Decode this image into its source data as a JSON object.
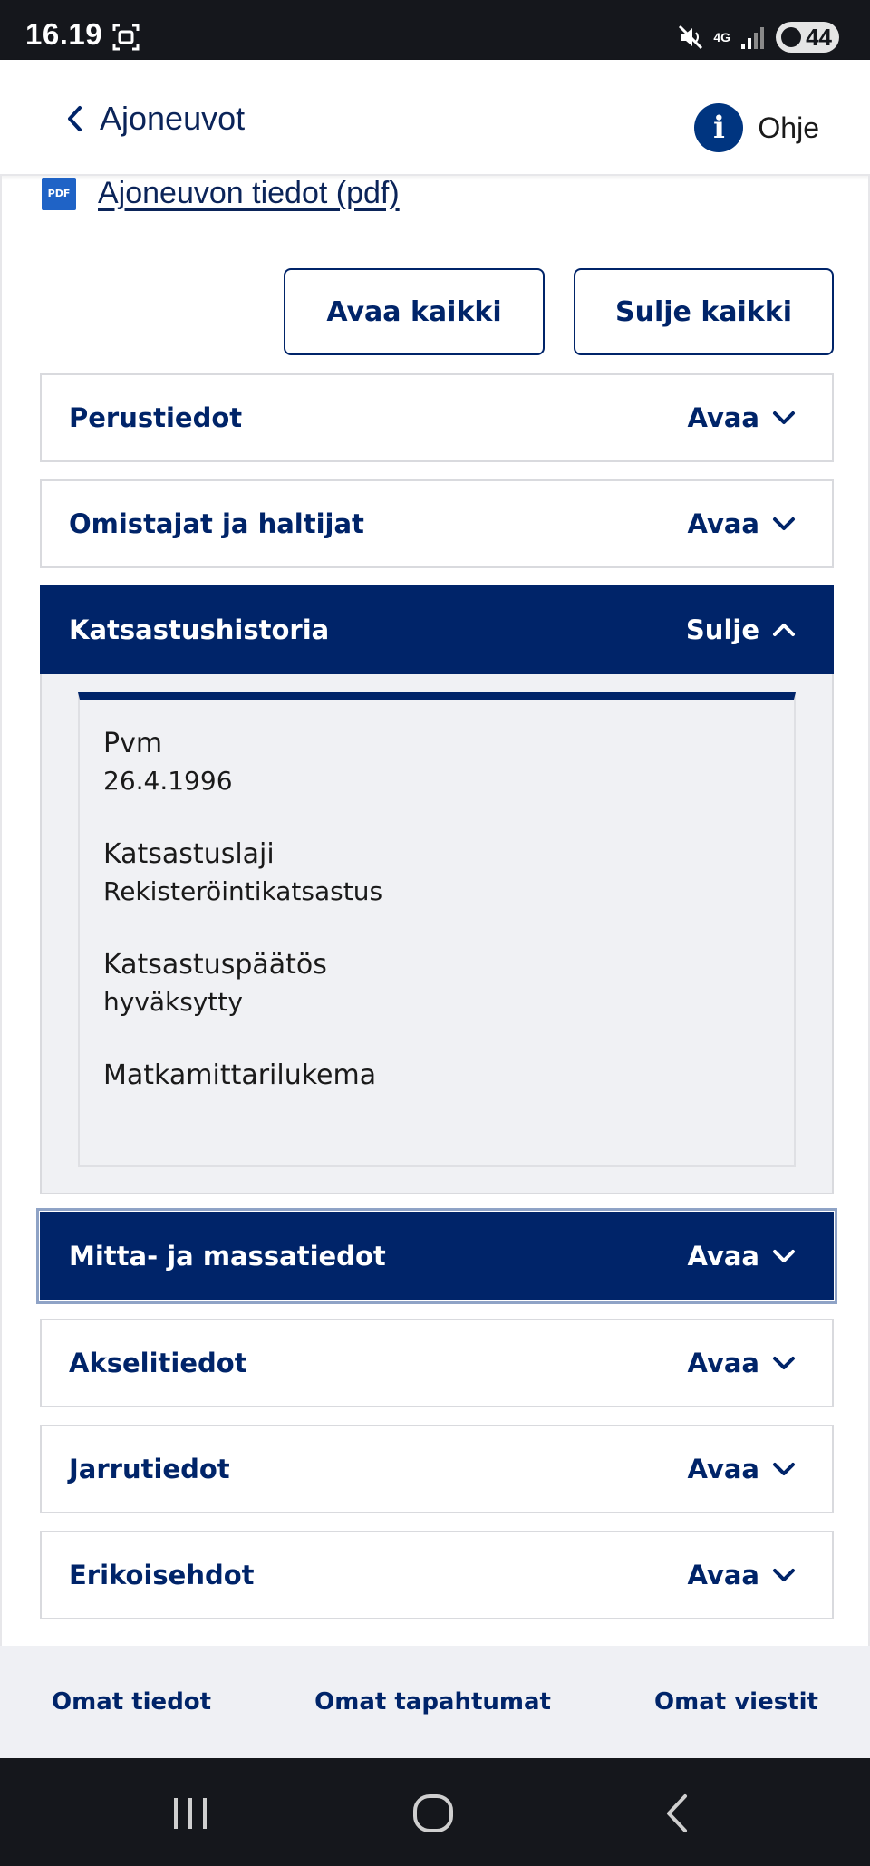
{
  "status_bar": {
    "time": "16.19",
    "network": "4G",
    "battery": "44"
  },
  "header": {
    "back_label": "Ajoneuvot",
    "help_label": "Ohje",
    "help_icon_glyph": "i"
  },
  "pdf_link": {
    "icon_text": "PDF",
    "label": "Ajoneuvon tiedot (pdf)"
  },
  "actions": {
    "open_all": "Avaa kaikki",
    "close_all": "Sulje kaikki"
  },
  "sections": [
    {
      "title": "Perustiedot",
      "toggle": "Avaa",
      "state": "collapsed"
    },
    {
      "title": "Omistajat ja haltijat",
      "toggle": "Avaa",
      "state": "collapsed"
    },
    {
      "title": "Katsastushistoria",
      "toggle": "Sulje",
      "state": "expanded"
    },
    {
      "title": "Mitta- ja massatiedot",
      "toggle": "Avaa",
      "state": "collapsed-focused"
    },
    {
      "title": "Akselitiedot",
      "toggle": "Avaa",
      "state": "collapsed"
    },
    {
      "title": "Jarrutiedot",
      "toggle": "Avaa",
      "state": "collapsed"
    },
    {
      "title": "Erikoisehdot",
      "toggle": "Avaa",
      "state": "collapsed"
    }
  ],
  "inspection_record": {
    "fields": [
      {
        "name": "Pvm",
        "value": "26.4.1996"
      },
      {
        "name": "Katsastuslaji",
        "value": "Rekisteröintikatsastus"
      },
      {
        "name": "Katsastuspäätös",
        "value": "hyväksytty"
      },
      {
        "name": "Matkamittarilukema",
        "value": ""
      }
    ]
  },
  "bottom_nav": [
    {
      "label": "Omat tiedot"
    },
    {
      "label": "Omat tapahtumat"
    },
    {
      "label": "Omat viestit"
    }
  ],
  "colors": {
    "primary": "#002469",
    "panel_bg": "#f0f1f4",
    "statusbar_bg": "#15171c"
  }
}
